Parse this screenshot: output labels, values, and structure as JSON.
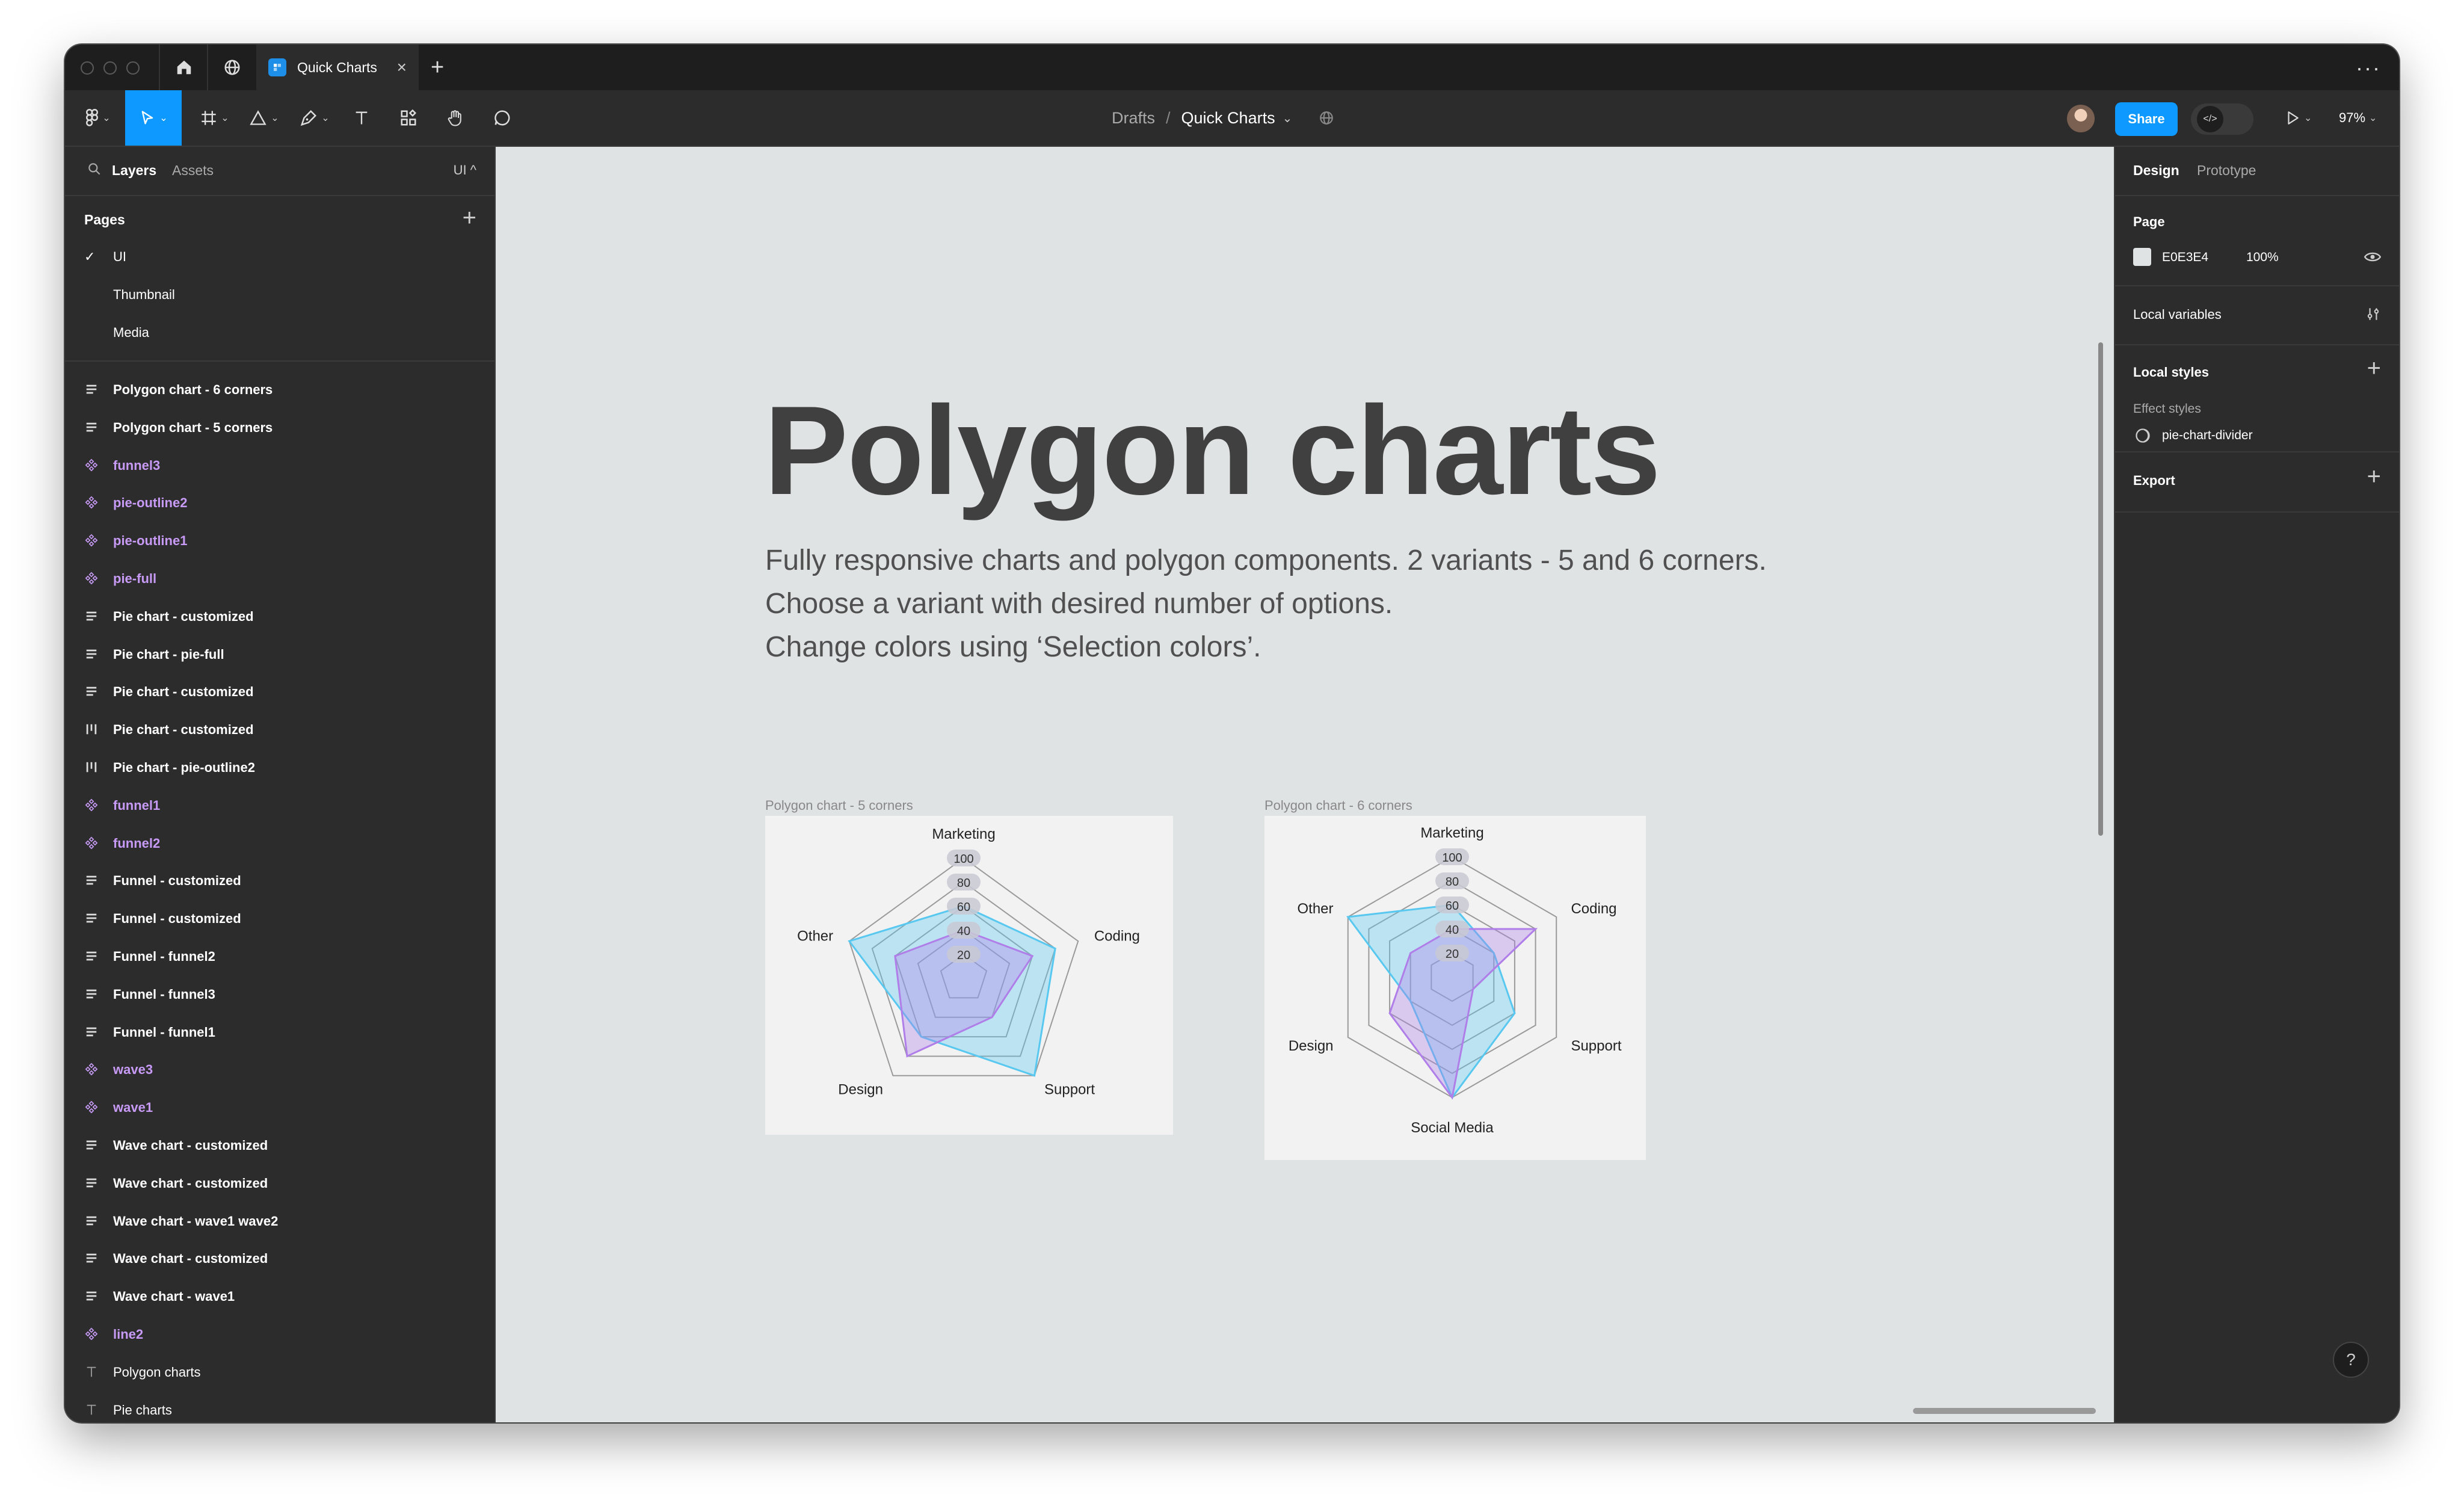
{
  "titlebar": {
    "tab_title": "Quick Charts",
    "tab_close": "×",
    "new_tab": "+",
    "more": "···"
  },
  "toolbar": {
    "breadcrumb_parent": "Drafts",
    "breadcrumb_sep": "/",
    "file_name": "Quick Charts",
    "share_label": "Share",
    "zoom": "97%"
  },
  "left_panel": {
    "tab_layers": "Layers",
    "tab_assets": "Assets",
    "page_switch": "UI ^",
    "pages_title": "Pages",
    "add": "+",
    "pages": [
      {
        "label": "UI",
        "current": true
      },
      {
        "label": "Thumbnail",
        "current": false
      },
      {
        "label": "Media",
        "current": false
      }
    ],
    "layers": [
      {
        "name": "Polygon chart - 6 corners",
        "type": "auto-layout"
      },
      {
        "name": "Polygon chart - 5 corners",
        "type": "auto-layout"
      },
      {
        "name": "funnel3",
        "type": "component"
      },
      {
        "name": "pie-outline2",
        "type": "component"
      },
      {
        "name": "pie-outline1",
        "type": "component"
      },
      {
        "name": "pie-full",
        "type": "component"
      },
      {
        "name": "Pie chart - customized",
        "type": "auto-layout"
      },
      {
        "name": "Pie chart - pie-full",
        "type": "auto-layout"
      },
      {
        "name": "Pie chart - customized",
        "type": "auto-layout"
      },
      {
        "name": "Pie chart - customized",
        "type": "auto-layout-h"
      },
      {
        "name": "Pie chart - pie-outline2",
        "type": "auto-layout-h"
      },
      {
        "name": "funnel1",
        "type": "component"
      },
      {
        "name": "funnel2",
        "type": "component"
      },
      {
        "name": "Funnel - customized",
        "type": "auto-layout"
      },
      {
        "name": "Funnel - customized",
        "type": "auto-layout"
      },
      {
        "name": "Funnel - funnel2",
        "type": "auto-layout"
      },
      {
        "name": "Funnel - funnel3",
        "type": "auto-layout"
      },
      {
        "name": "Funnel - funnel1",
        "type": "auto-layout"
      },
      {
        "name": "wave3",
        "type": "component"
      },
      {
        "name": "wave1",
        "type": "component"
      },
      {
        "name": "Wave chart - customized",
        "type": "auto-layout"
      },
      {
        "name": "Wave chart - customized",
        "type": "auto-layout"
      },
      {
        "name": "Wave chart - wave1 wave2",
        "type": "auto-layout"
      },
      {
        "name": "Wave chart - customized",
        "type": "auto-layout"
      },
      {
        "name": "Wave chart - wave1",
        "type": "auto-layout"
      },
      {
        "name": "line2",
        "type": "component"
      },
      {
        "name": "Polygon charts",
        "type": "text"
      },
      {
        "name": "Pie charts",
        "type": "text"
      }
    ]
  },
  "canvas": {
    "title": "Polygon charts",
    "desc1": "Fully responsive charts and polygon components. 2 variants - 5 and 6 corners.",
    "desc2": "Choose a variant with desired number of options.",
    "desc3": "Change colors using ‘Selection colors’.",
    "frame5_label": "Polygon chart - 5 corners",
    "frame6_label": "Polygon chart - 6 corners"
  },
  "right_panel": {
    "tab_design": "Design",
    "tab_prototype": "Prototype",
    "page_heading": "Page",
    "page_color": "E0E3E4",
    "page_opacity": "100%",
    "local_variables": "Local variables",
    "local_styles": "Local styles",
    "effect_styles": "Effect styles",
    "effect_style_name": "pie-chart-divider",
    "export": "Export",
    "add": "+",
    "help": "?"
  },
  "colors": {
    "accent": "#0d99ff",
    "panel": "#2c2c2c",
    "canvas": "#e0e3e4",
    "component": "#c79af5",
    "series_blue": "#58c8f0",
    "series_purple": "#b07ee8"
  },
  "chart_data": [
    {
      "type": "radar",
      "title": "Polygon chart - 5 corners",
      "categories": [
        "Marketing",
        "Coding",
        "Support",
        "Design",
        "Other"
      ],
      "ticks": [
        "20",
        "40",
        "60",
        "80",
        "100"
      ],
      "range": [
        0,
        100
      ],
      "series": [
        {
          "color": "#58c8f0",
          "values": [
            60,
            80,
            100,
            60,
            100
          ]
        },
        {
          "color": "#b07ee8",
          "values": [
            40,
            60,
            40,
            80,
            60
          ]
        }
      ]
    },
    {
      "type": "radar",
      "title": "Polygon chart - 6 corners",
      "categories": [
        "Marketing",
        "Coding",
        "Support",
        "Social Media",
        "Design",
        "Other"
      ],
      "ticks": [
        "20",
        "40",
        "60",
        "80",
        "100"
      ],
      "range": [
        0,
        100
      ],
      "series": [
        {
          "color": "#58c8f0",
          "values": [
            60,
            40,
            60,
            100,
            40,
            100
          ]
        },
        {
          "color": "#b07ee8",
          "values": [
            40,
            80,
            20,
            100,
            60,
            40
          ]
        }
      ]
    }
  ]
}
